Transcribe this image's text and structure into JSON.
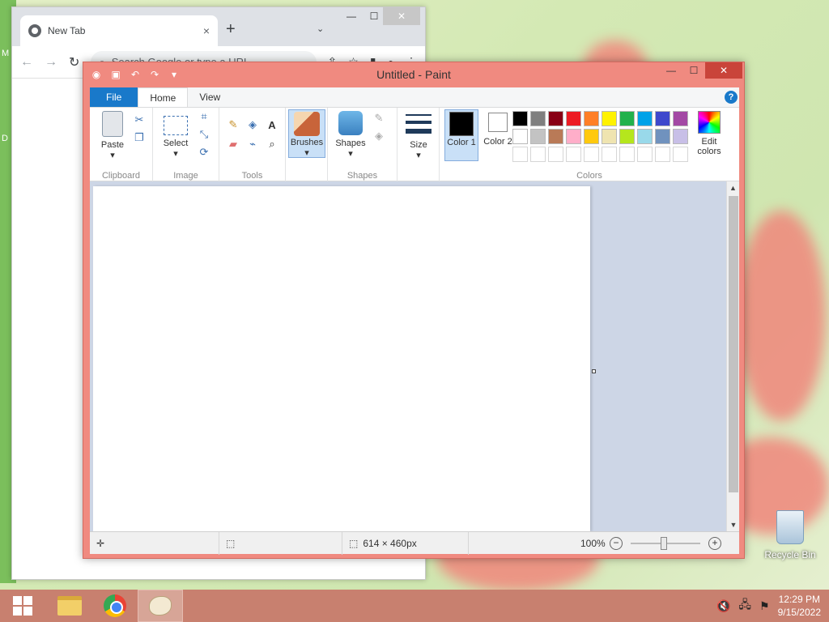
{
  "chrome": {
    "tab_title": "New Tab",
    "tab_close": "×",
    "new_tab": "+",
    "tab_search": "⌄",
    "minimize": "—",
    "maximize": "☐",
    "close": "✕",
    "back": "←",
    "forward": "→",
    "reload": "↻",
    "omnibox_placeholder": "Search Google or type a URL"
  },
  "paint": {
    "title": "Untitled - Paint",
    "tabs": {
      "file": "File",
      "home": "Home",
      "view": "View"
    },
    "help": "?",
    "groups": {
      "clipboard": {
        "label": "Clipboard",
        "paste": "Paste"
      },
      "image": {
        "label": "Image",
        "select": "Select"
      },
      "tools": {
        "label": "Tools"
      },
      "brushes": {
        "label": "Brushes"
      },
      "shapes": {
        "label": "Shapes",
        "shapes": "Shapes"
      },
      "size": {
        "label": "Size"
      },
      "colors": {
        "label": "Colors",
        "color1": "Color 1",
        "color2": "Color 2",
        "edit_colors": "Edit colors",
        "palette_row1": [
          "#000000",
          "#7f7f7f",
          "#880015",
          "#ed1c24",
          "#ff7f27",
          "#fff200",
          "#22b14c",
          "#00a2e8",
          "#3f48cc",
          "#a349a4"
        ],
        "palette_row2": [
          "#ffffff",
          "#c3c3c3",
          "#b97a57",
          "#ffaec9",
          "#ffc90e",
          "#efe4b0",
          "#b5e61d",
          "#99d9ea",
          "#7092be",
          "#c8bfe7"
        ],
        "color1_value": "#000000",
        "color2_value": "#ffffff"
      }
    },
    "status": {
      "canvas_size": "614 × 460px",
      "zoom": "100%",
      "zoom_out": "−",
      "zoom_in": "+"
    }
  },
  "desktop": {
    "recycle_bin": "Recycle Bin",
    "left_fragments": [
      "M",
      "D"
    ]
  },
  "taskbar": {
    "time": "12:29 PM",
    "date": "9/15/2022"
  }
}
